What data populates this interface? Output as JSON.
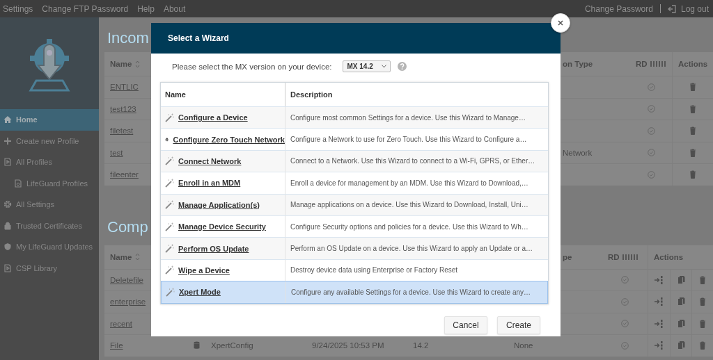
{
  "top_menu": [
    {
      "label": "Settings"
    },
    {
      "label": "Change FTP Password"
    },
    {
      "label": "Help"
    },
    {
      "label": "About"
    }
  ],
  "top_links": {
    "change_password": "Change Password",
    "logout": "Log out"
  },
  "sidebar": {
    "items": [
      {
        "label": "Home",
        "kind": "home",
        "selected": true
      },
      {
        "label": "Create new Profile",
        "kind": "plus",
        "selected": false
      },
      {
        "label": "All Profiles",
        "kind": "doc",
        "selected": false,
        "children": [
          {
            "label": "LifeGuard Profiles",
            "kind": "doc",
            "selected": false
          }
        ]
      },
      {
        "label": "All Settings",
        "kind": "gear",
        "selected": false
      },
      {
        "label": "Trusted Certificates",
        "kind": "lock",
        "selected": false
      },
      {
        "label": "My LifeGuard Updates",
        "kind": "shield",
        "selected": false
      },
      {
        "label": "CSP Library",
        "kind": "doc",
        "selected": false
      }
    ]
  },
  "incoming": {
    "title": "Incom",
    "columns": [
      "Name",
      "on Type",
      "RD",
      "Actions"
    ],
    "rows": [
      {
        "name": "ENTLIC"
      },
      {
        "name": "test123"
      },
      {
        "name": "filetest"
      },
      {
        "name": "test",
        "type": "Network"
      },
      {
        "name": "fileenter"
      }
    ]
  },
  "completed": {
    "title": "Comp",
    "columns": [
      "Name",
      "pe",
      "RD",
      "Actions"
    ],
    "rows": [
      {
        "name": "Deletefile"
      },
      {
        "name": "enterprise"
      },
      {
        "name": "recent"
      },
      {
        "name": "File",
        "config": "XpertConfig",
        "date": "9/24/2025 10:53 PM",
        "version": "14.2",
        "type": "None"
      }
    ]
  },
  "modal": {
    "title": "Select a Wizard",
    "mx_label": "Please select the MX version on your device:",
    "mx_version": "MX 14.2",
    "columns": [
      "Name",
      "Description"
    ],
    "wizards": [
      {
        "name": "Configure a Device",
        "description": "Configure most common Settings for a device. Use this Wizard to Manage…",
        "kind": "wand",
        "selected": false
      },
      {
        "name": "Configure Zero Touch Network",
        "description": "Configure a Network to use for Zero Touch. Use this Wizard to Configure a…",
        "kind": "android",
        "selected": false
      },
      {
        "name": "Connect Network",
        "description": "Connect to a Network. Use this Wizard to connect to a Wi-Fi, GPRS, or Ether…",
        "kind": "wand",
        "selected": false
      },
      {
        "name": "Enroll in an MDM",
        "description": "Enroll a device for management by an MDM.  Use this Wizard to Download,…",
        "kind": "wand",
        "selected": false
      },
      {
        "name": "Manage Application(s)",
        "description": "Manage applications on a device.  Use this Wizard to Download, Install, Uni…",
        "kind": "wand",
        "selected": false
      },
      {
        "name": "Manage Device Security",
        "description": "Configure Security options and policies for a device.  Use this Wizard to Wh…",
        "kind": "wand",
        "selected": false
      },
      {
        "name": "Perform OS Update",
        "description": "Perform an OS Update on a device.  Use this Wizard to apply an Update or a…",
        "kind": "wand",
        "selected": false
      },
      {
        "name": "Wipe a Device",
        "description": "Destroy device data using Enterprise or Factory Reset",
        "kind": "wand",
        "selected": false
      },
      {
        "name": "Xpert Mode",
        "description": "Configure any available Settings for a device. Use this Wizard to create any…",
        "kind": "wand",
        "selected": true
      }
    ],
    "buttons": [
      "Cancel",
      "Create"
    ]
  }
}
